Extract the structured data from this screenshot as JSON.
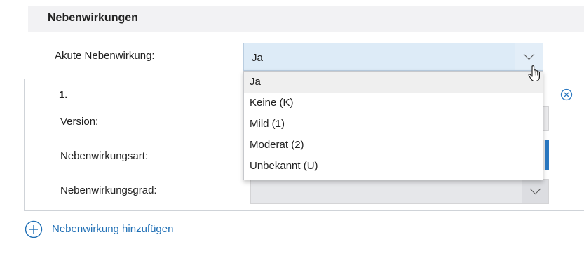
{
  "section": {
    "title": "Nebenwirkungen"
  },
  "acute": {
    "label": "Akute Nebenwirkung:",
    "value": "Ja",
    "options": [
      "Ja",
      "Keine (K)",
      "Mild (1)",
      "Moderat (2)",
      "Unbekannt (U)"
    ],
    "selected_option": "Ja"
  },
  "entry": {
    "number": "1.",
    "version_label": "Version:",
    "art_label": "Nebenwirkungsart:",
    "grad_label": "Nebenwirkungsgrad:"
  },
  "add": {
    "label": "Nebenwirkung hinzufügen"
  },
  "icons": {
    "dropdown": "chevron-down-icon",
    "cursor": "hand-cursor-icon",
    "remove": "close-circle-icon",
    "add": "plus-circle-icon"
  },
  "colors": {
    "combo_bg": "#ddebf7",
    "accent": "#2a78c2",
    "link": "#1f6fb5",
    "header_bg": "#f2f2f4"
  }
}
